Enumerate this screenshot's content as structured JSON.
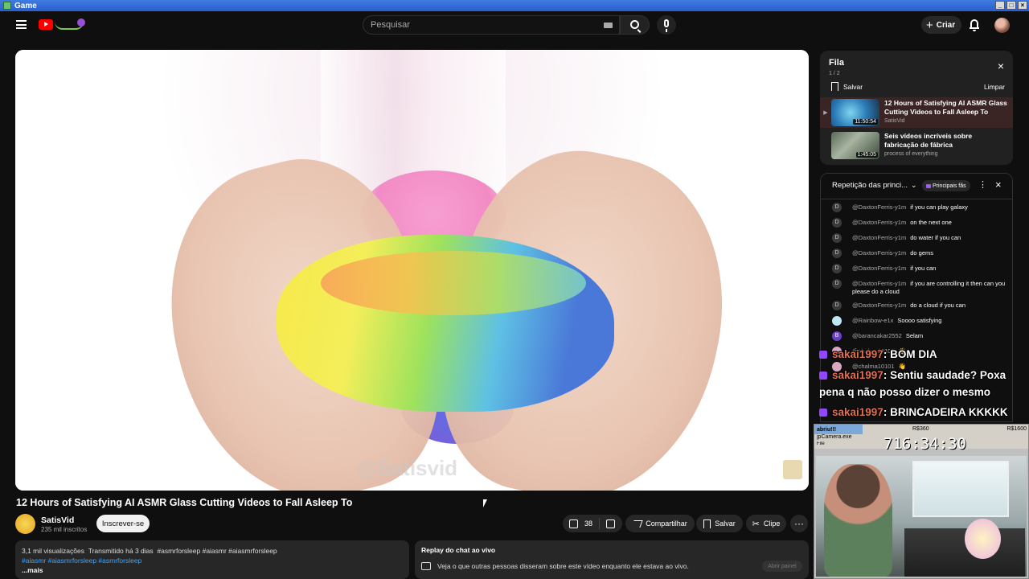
{
  "window": {
    "title": "Game"
  },
  "topbar": {
    "search_placeholder": "Pesquisar",
    "create_label": "Criar"
  },
  "player": {
    "watermark": "@Satisvid"
  },
  "video": {
    "title": "12 Hours of Satisfying AI ASMR Glass Cutting Videos to Fall Asleep To",
    "channel": "SatisVid",
    "subscribers": "235 mil inscritos",
    "subscribe_label": "Inscrever-se",
    "likes": "38",
    "share_label": "Compartilhar",
    "save_label": "Salvar",
    "clip_label": "Clipe",
    "more_label": "···"
  },
  "description": {
    "views": "3,1 mil visualizações",
    "streamed": "Transmitido há 3 dias",
    "tags_inline": "#asmrforsleep #aiasmr #aiasmrforsleep",
    "tags_line2": "#aiasmr #aiasmrforsleep #asmrforsleep",
    "more": "...mais"
  },
  "replay": {
    "title": "Replay do chat ao vivo",
    "text": "Veja o que outras pessoas disseram sobre este vídeo enquanto ele estava ao vivo.",
    "button": "Abrir painel"
  },
  "queue": {
    "title": "Fila",
    "count": "1 / 2",
    "save_label": "Salvar",
    "clear_label": "Limpar",
    "items": [
      {
        "title": "12 Hours of Satisfying AI ASMR Glass Cutting Videos to Fall Asleep To",
        "channel": "SatisVid",
        "duration": "11:50:54"
      },
      {
        "title": "Seis vídeos incríveis sobre fabricação de fábrica",
        "channel": "process of everything",
        "duration": "1:45:05"
      }
    ]
  },
  "chat": {
    "header": "Repetição das princi...",
    "badge": "Principais fãs",
    "messages": [
      {
        "initial": "D",
        "author": "@DaxtonFerris-y1m",
        "text": "if you can play galaxy"
      },
      {
        "initial": "D",
        "author": "@DaxtonFerris-y1m",
        "text": "on the next one"
      },
      {
        "initial": "D",
        "author": "@DaxtonFerris-y1m",
        "text": "do water if you can"
      },
      {
        "initial": "D",
        "author": "@DaxtonFerris-y1m",
        "text": "do gems"
      },
      {
        "initial": "D",
        "author": "@DaxtonFerris-y1m",
        "text": "if you can"
      },
      {
        "initial": "D",
        "author": "@DaxtonFerris-y1m",
        "text": "if you are controlling it then can you please do a cloud"
      },
      {
        "initial": "D",
        "author": "@DaxtonFerris-y1m",
        "text": "do a cloud if you can"
      },
      {
        "initial": "",
        "author": "@Rainbow-e1x",
        "text": "Soooo satisfying"
      },
      {
        "initial": "B",
        "author": "@barancakar2552",
        "text": "Selam"
      },
      {
        "initial": "",
        "author": "@chalma10101",
        "text": "👋"
      },
      {
        "initial": "",
        "author": "@chalma10101",
        "text": "👋"
      }
    ]
  },
  "overlay": {
    "nick": "sakai1997",
    "lines": [
      ": BOM DIA",
      ": Sentiu saudade? Poxa",
      "pena q não posso dizer o mesmo",
      ": BRINCADEIRA KKKKK"
    ]
  },
  "cam": {
    "goal1": "abriu!!!",
    "goal2": "R$360",
    "goal3": "R$1600",
    "title": "jpCamera.exe",
    "menu": "File",
    "timer": "716:34:30"
  }
}
